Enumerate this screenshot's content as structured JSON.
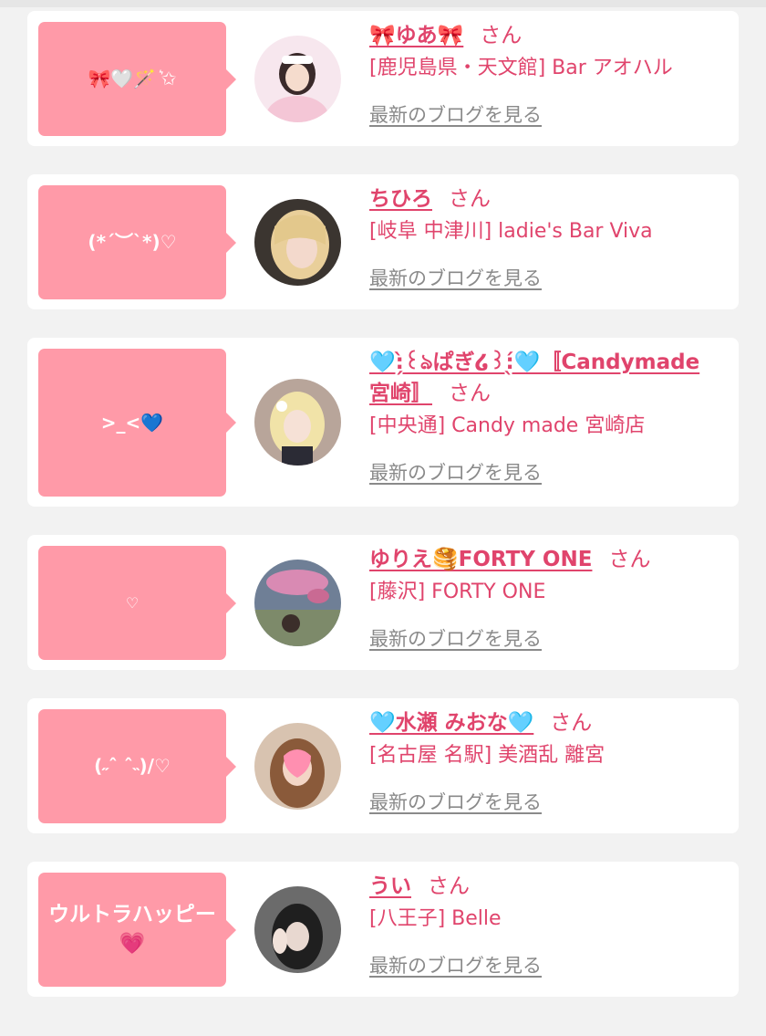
{
  "cards": [
    {
      "bubble": "🎀🤍🪄 ͛✩",
      "name": "🎀ゆあ🎀",
      "san": "さん",
      "shop": "[鹿児島県・天文館] Bar アオハル",
      "blog": "最新のブログを見る"
    },
    {
      "bubble": "(*´︶`*)♡",
      "name": "ちひろ",
      "san": "さん",
      "shop": "[岐阜 中津川] ladie's Bar Viva",
      "blog": "最新のブログを見る"
    },
    {
      "bubble": ">_<💙",
      "name": "🩵:̗̀꒰ঌぱぎ໒꒱:̖́🩵〚Candymade宮崎〛",
      "san": "さん",
      "shop": "[中央通] Candy made 宮崎店",
      "blog": "最新のブログを見る"
    },
    {
      "bubble": "♡",
      "name": "ゆりえ🥞FORTY ONE",
      "san": "さん",
      "shop": "[藤沢] FORTY ONE",
      "blog": "最新のブログを見る"
    },
    {
      "bubble": "(˶ˆ ˆ˵)/♡",
      "name": "🩵水瀬 みおな🩵",
      "san": "さん",
      "shop": "[名古屋 名駅] 美酒乱 離宮",
      "blog": "最新のブログを見る"
    },
    {
      "bubble": "ウルトラハッピー💗",
      "name": "うい",
      "san": "さん",
      "shop": "[八王子] Belle",
      "blog": "最新のブログを見る"
    }
  ],
  "colors": {
    "background": "#f2f2f2",
    "card": "#ffffff",
    "bubble": "#ff9aa8",
    "accent": "#e0446c",
    "muted": "#8a8a8a"
  }
}
